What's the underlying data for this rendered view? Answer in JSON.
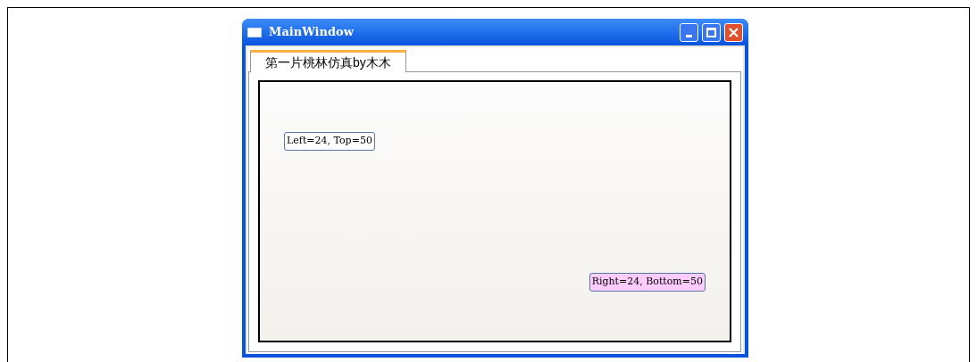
{
  "window": {
    "title": "MainWindow"
  },
  "tabs": [
    {
      "label": "第一片桃林仿真by木木",
      "selected": true
    }
  ],
  "canvas": {
    "buttons": [
      {
        "label": "Left=24, Top=50",
        "kind": "topleft",
        "color": "#ffffff"
      },
      {
        "label": "Right=24, Bottom=50",
        "kind": "bottomright",
        "color": "#ffccff"
      }
    ]
  }
}
